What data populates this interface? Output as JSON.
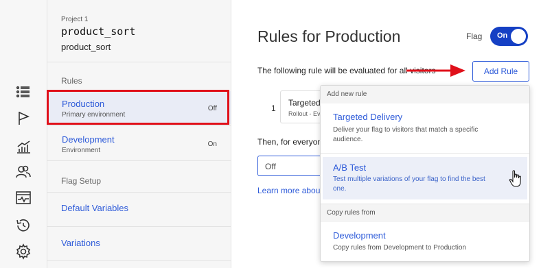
{
  "rail": {
    "icons": [
      "list-icon",
      "flag-icon",
      "chart-icon",
      "users-icon",
      "monitor-icon",
      "history-icon",
      "gear-icon"
    ]
  },
  "sidebar": {
    "project_label": "Project 1",
    "flag_key": "product_sort",
    "flag_name": "product_sort",
    "rules_section": "Rules",
    "environments": [
      {
        "name": "Production",
        "description": "Primary environment",
        "status": "Off"
      },
      {
        "name": "Development",
        "description": "Environment",
        "status": "On"
      }
    ],
    "flag_setup_section": "Flag Setup",
    "links": [
      "Default Variables",
      "Variations"
    ]
  },
  "main": {
    "title": "Rules for Production",
    "flag_label": "Flag",
    "flag_toggle": "On",
    "intro_text": "The following rule will be evaluated for all visitors",
    "add_rule_label": "Add Rule",
    "rule_number": "1",
    "rule_card_title": "Targeted Delivery",
    "rule_card_sub": "Rollout - Everyone",
    "then_text": "Then, for everyone else who doesn't match the rules above",
    "default_select": "Off",
    "learn_more": "Learn more about rules"
  },
  "dropdown": {
    "add_header": "Add new rule",
    "items": [
      {
        "title": "Targeted Delivery",
        "description": "Deliver your flag to visitors that match a specific audience."
      },
      {
        "title": "A/B Test",
        "description": "Test multiple variations of your flag to find the best one."
      }
    ],
    "copy_header": "Copy rules from",
    "copy_item": {
      "title": "Development",
      "description": "Copy rules from Development to Production"
    }
  },
  "colors": {
    "accent": "#2e5bd9",
    "toggle_on": "#1540c4",
    "highlight": "#e0101a"
  }
}
